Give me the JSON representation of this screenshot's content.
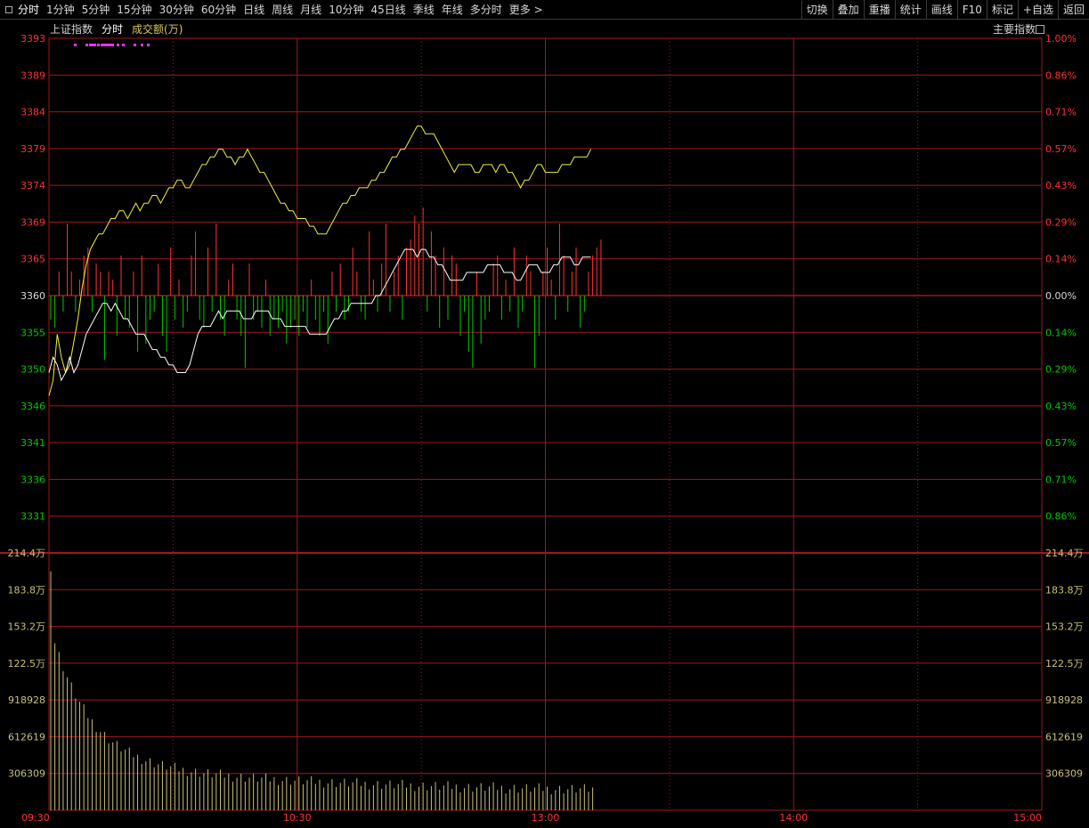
{
  "toolbar": {
    "tabs": [
      "分时",
      "1分钟",
      "5分钟",
      "15分钟",
      "30分钟",
      "60分钟",
      "日线",
      "周线",
      "月线",
      "10分钟",
      "45日线",
      "季线",
      "年线",
      "多分时",
      "更多 >"
    ],
    "active_tab": "分时",
    "right_tools": [
      "切换",
      "叠加",
      "重播",
      "统计",
      "画线",
      "F10",
      "标记",
      "+自选",
      "返回"
    ]
  },
  "subheader": {
    "index_name": "上证指数",
    "mode": "分时",
    "volume_label": "成交额(万)",
    "right_label": "主要指数"
  },
  "colors": {
    "grid": "#a01818",
    "up": "#ff3232",
    "down": "#00c800",
    "yellow": "#f0f040",
    "white": "#ffffff",
    "volume": "#c8c078",
    "magenta": "#ff30ff"
  },
  "chart_data": {
    "type": "line",
    "price_axis": {
      "base": 3360,
      "left_labels": [
        "3393",
        "3389",
        "3384",
        "3379",
        "3374",
        "3369",
        "3365",
        "3360",
        "3355",
        "3350",
        "3346",
        "3341",
        "3336",
        "3331"
      ],
      "right_labels": [
        "1.00%",
        "0.86%",
        "0.71%",
        "0.57%",
        "0.43%",
        "0.29%",
        "0.14%",
        "0.00%",
        "0.14%",
        "0.29%",
        "0.43%",
        "0.57%",
        "0.71%",
        "0.86%"
      ],
      "top": 3393.4,
      "bottom": 3326.6
    },
    "volume_axis": {
      "left_labels": [
        "214.4万",
        "183.8万",
        "153.2万",
        "122.5万",
        "918928",
        "612619",
        "306309"
      ],
      "right_labels": [
        "214.4万",
        "183.8万",
        "153.2万",
        "122.5万",
        "918928",
        "612619",
        "306309"
      ],
      "max": 2144000
    },
    "time_labels": [
      "09:30",
      "10:30",
      "13:00",
      "14:00",
      "15:00"
    ],
    "time_slots": 240,
    "series": [
      {
        "values": [
          3347,
          3349,
          3355,
          3352,
          3350,
          3351,
          3354,
          3357,
          3361,
          3364,
          3366,
          3367,
          3368,
          3368,
          3369,
          3370,
          3370,
          3371,
          3371,
          3370,
          3371,
          3372,
          3371,
          3372,
          3372,
          3373,
          3373,
          3372,
          3373,
          3374,
          3374,
          3375,
          3375,
          3374,
          3374,
          3375,
          3376,
          3377,
          3377,
          3378,
          3378,
          3379,
          3379,
          3378,
          3378,
          3377,
          3378,
          3378,
          3379,
          3378,
          3377,
          3376,
          3376,
          3375,
          3374,
          3373,
          3372,
          3372,
          3371,
          3371,
          3370,
          3370,
          3370,
          3369,
          3369,
          3368,
          3368,
          3368,
          3369,
          3370,
          3371,
          3372,
          3372,
          3373,
          3373,
          3374,
          3374,
          3374,
          3375,
          3375,
          3376,
          3376,
          3377,
          3378,
          3378,
          3379,
          3379,
          3380,
          3381,
          3382,
          3382,
          3381,
          3381,
          3381,
          3380,
          3379,
          3378,
          3377,
          3376,
          3377,
          3377,
          3377,
          3377,
          3376,
          3376,
          3377,
          3377,
          3377,
          3376,
          3377,
          3377,
          3376,
          3376,
          3375,
          3374,
          3375,
          3375,
          3376,
          3377,
          3377,
          3376,
          3376,
          3376,
          3376,
          3377,
          3377,
          3377,
          3378,
          3378,
          3378,
          3378,
          3379
        ]
      },
      {
        "values": [
          3350,
          3352,
          3351,
          3349,
          3350,
          3352,
          3350,
          3351,
          3353,
          3355,
          3356,
          3357,
          3358,
          3359,
          3359,
          3358,
          3359,
          3358,
          3357,
          3357,
          3356,
          3355,
          3355,
          3355,
          3354,
          3353,
          3353,
          3352,
          3352,
          3351,
          3351,
          3350,
          3350,
          3350,
          3351,
          3353,
          3355,
          3356,
          3356,
          3356,
          3357,
          3358,
          3357,
          3358,
          3358,
          3358,
          3358,
          3357,
          3357,
          3357,
          3358,
          3358,
          3358,
          3358,
          3357,
          3357,
          3357,
          3356,
          3356,
          3356,
          3356,
          3356,
          3356,
          3355,
          3355,
          3355,
          3355,
          3355,
          3356,
          3357,
          3357,
          3358,
          3358,
          3359,
          3359,
          3359,
          3359,
          3359,
          3359,
          3360,
          3360,
          3361,
          3362,
          3363,
          3364,
          3365,
          3366,
          3366,
          3366,
          3365,
          3366,
          3366,
          3365,
          3365,
          3364,
          3364,
          3363,
          3362,
          3362,
          3362,
          3362,
          3363,
          3363,
          3363,
          3363,
          3363,
          3364,
          3364,
          3364,
          3364,
          3363,
          3363,
          3363,
          3362,
          3362,
          3363,
          3364,
          3364,
          3364,
          3363,
          3363,
          3363,
          3364,
          3364,
          3365,
          3365,
          3365,
          3364,
          3364,
          3365,
          3365,
          3365
        ]
      }
    ],
    "diff_bars": [
      -3,
      -4,
      3,
      -2,
      9,
      3,
      -2,
      2,
      5,
      6,
      -2,
      4,
      3,
      -8,
      3,
      2,
      -5,
      5,
      -3,
      -4,
      3,
      -7,
      5,
      -6,
      -3,
      -2,
      4,
      -5,
      -7,
      6,
      -3,
      2,
      -4,
      -2,
      5,
      8,
      -3,
      -4,
      6,
      -2,
      9,
      -3,
      -5,
      2,
      4,
      -3,
      -5,
      -9,
      4,
      -3,
      -2,
      -4,
      2,
      -5,
      -3,
      -4,
      -2,
      -6,
      -4,
      -3,
      -5,
      -2,
      -4,
      2,
      -3,
      -5,
      -2,
      -6,
      3,
      -2,
      4,
      -3,
      -2,
      6,
      3,
      -2,
      -3,
      8,
      2,
      -2,
      4,
      9,
      -2,
      3,
      5,
      -3,
      6,
      7,
      10,
      9,
      11,
      -2,
      8,
      5,
      -4,
      6,
      -3,
      5,
      4,
      -5,
      -2,
      -7,
      -9,
      3,
      -6,
      -3,
      -2,
      4,
      5,
      -3,
      2,
      -2,
      6,
      -4,
      -2,
      5,
      3,
      -9,
      -5,
      3,
      6,
      2,
      -3,
      9,
      5,
      -2,
      3,
      6,
      -4,
      -2,
      3,
      5,
      6,
      7
    ]
  }
}
